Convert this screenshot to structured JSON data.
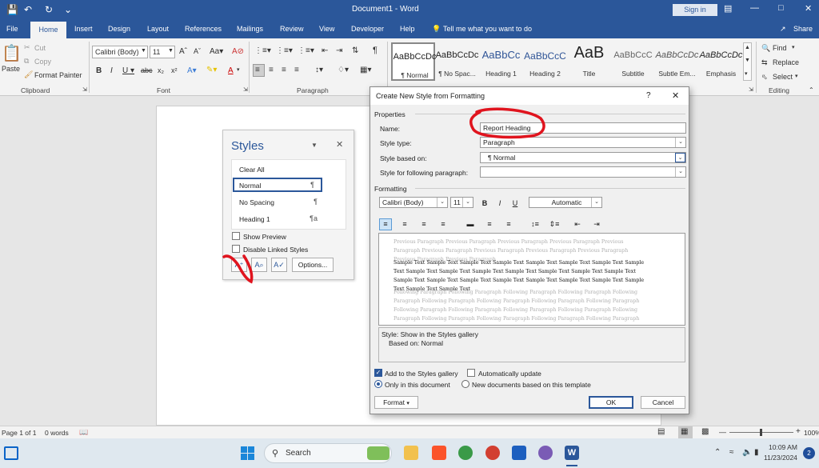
{
  "window": {
    "title": "Document1 - Word",
    "sign_in": "Sign in"
  },
  "tabs": [
    "File",
    "Home",
    "Insert",
    "Design",
    "Layout",
    "References",
    "Mailings",
    "Review",
    "View",
    "Developer",
    "Help"
  ],
  "tell_me": "Tell me what you want to do",
  "share": "Share",
  "clipboard": {
    "paste": "Paste",
    "cut": "Cut",
    "copy": "Copy",
    "format_painter": "Format Painter",
    "label": "Clipboard"
  },
  "font": {
    "name": "Calibri (Body)",
    "size": "11",
    "label": "Font"
  },
  "paragraph": {
    "label": "Paragraph"
  },
  "styles_gallery": [
    {
      "preview": "AaBbCcDc",
      "label": "¶ Normal"
    },
    {
      "preview": "AaBbCcDc",
      "label": "¶ No Spac..."
    },
    {
      "preview": "AaBbCc",
      "label": "Heading 1"
    },
    {
      "preview": "AaBbCcC",
      "label": "Heading 2"
    },
    {
      "preview": "AaB",
      "label": "Title"
    },
    {
      "preview": "AaBbCcC",
      "label": "Subtitle"
    },
    {
      "preview": "AaBbCcDc",
      "label": "Subtle Em..."
    },
    {
      "preview": "AaBbCcDc",
      "label": "Emphasis"
    }
  ],
  "editing": {
    "find": "Find",
    "replace": "Replace",
    "select": "Select",
    "label": "Editing"
  },
  "styles_pane": {
    "title": "Styles",
    "items": [
      {
        "label": "Clear All",
        "mark": ""
      },
      {
        "label": "Normal",
        "mark": "¶"
      },
      {
        "label": "No Spacing",
        "mark": "¶"
      },
      {
        "label": "Heading 1",
        "mark": "¶a"
      }
    ],
    "show_preview": "Show Preview",
    "disable_linked": "Disable Linked Styles",
    "options": "Options..."
  },
  "dialog": {
    "title": "Create New Style from Formatting",
    "help": "?",
    "properties": "Properties",
    "name_label": "Name:",
    "name_value": "Report Heading",
    "type_label": "Style type:",
    "type_value": "Paragraph",
    "based_label": "Style based on:",
    "based_value": "¶  Normal",
    "following_label": "Style for following paragraph:",
    "following_value": "",
    "formatting": "Formatting",
    "fmt_font": "Calibri (Body)",
    "fmt_size": "11",
    "fmt_color": "Automatic",
    "prev_para": "Previous Paragraph Previous Paragraph Previous Paragraph Previous Paragraph Previous Paragraph Previous Paragraph Previous Paragraph Previous Paragraph Previous Paragraph Previous Paragraph Previous Paragraph",
    "sample_text": "Sample Text Sample Text Sample Text Sample Text Sample Text Sample Text Sample Text Sample Text Sample Text Sample Text Sample Text Sample Text Sample Text Sample Text Sample Text Sample Text Sample Text Sample Text Sample Text Sample Text Sample Text Sample Text Sample Text Sample Text Sample Text",
    "follow_para": "Following Paragraph Following Paragraph Following Paragraph Following Paragraph Following Paragraph Following Paragraph Following Paragraph Following Paragraph Following Paragraph Following Paragraph Following Paragraph Following Paragraph Following Paragraph Following Paragraph Following Paragraph Following Paragraph Following Paragraph Following Paragraph Following Paragraph Following Paragraph Following Paragraph Following Paragraph Following Paragraph Following Paragraph Following Paragraph",
    "desc_line1": "Style: Show in the Styles gallery",
    "desc_line2": "Based on: Normal",
    "add_gallery": "Add to the Styles gallery",
    "auto_update": "Automatically update",
    "only_doc": "Only in this document",
    "new_docs": "New documents based on this template",
    "format_btn": "Format",
    "ok": "OK",
    "cancel": "Cancel"
  },
  "status": {
    "page": "Page 1 of 1",
    "words": "0 words",
    "zoom": "100%"
  },
  "taskbar": {
    "search": "Search",
    "time": "10:09 AM",
    "date": "11/23/2024",
    "badge": "2"
  },
  "colors": {
    "word_blue": "#2b579a",
    "annotation_red": "#e0141e"
  }
}
